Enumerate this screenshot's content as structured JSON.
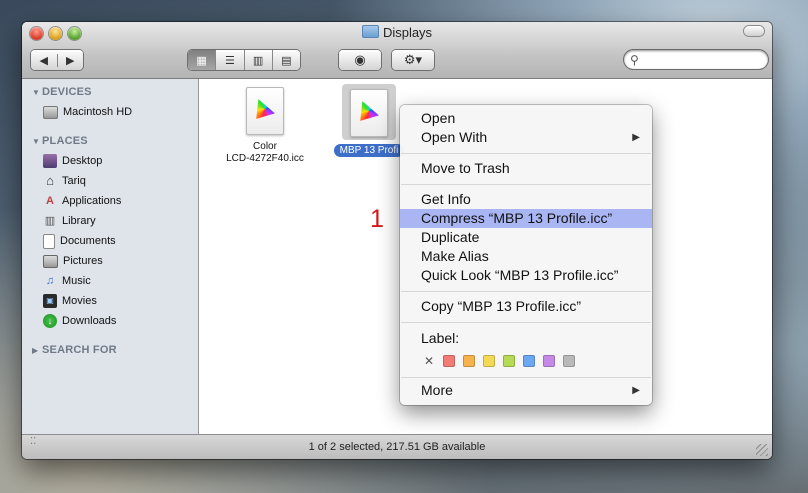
{
  "window": {
    "title": "Displays"
  },
  "toolbar": {
    "back_glyph": "◀",
    "forward_glyph": "▶",
    "view_icon_glyph": "▦",
    "view_list_glyph": "☰",
    "view_columns_glyph": "▥",
    "view_coverflow_glyph": "▤",
    "quicklook_glyph": "◉",
    "action_glyph": "⚙▾",
    "search_icon_glyph": "⚲",
    "search_placeholder": ""
  },
  "sidebar": {
    "sections": [
      {
        "title": "DEVICES",
        "items": [
          {
            "label": "Macintosh HD",
            "icon": "hard-drive-icon"
          }
        ]
      },
      {
        "title": "PLACES",
        "items": [
          {
            "label": "Desktop",
            "icon": "desktop-icon"
          },
          {
            "label": "Tariq",
            "icon": "home-icon"
          },
          {
            "label": "Applications",
            "icon": "applications-icon"
          },
          {
            "label": "Library",
            "icon": "library-icon"
          },
          {
            "label": "Documents",
            "icon": "documents-icon"
          },
          {
            "label": "Pictures",
            "icon": "pictures-icon"
          },
          {
            "label": "Music",
            "icon": "music-icon"
          },
          {
            "label": "Movies",
            "icon": "movies-icon"
          },
          {
            "label": "Downloads",
            "icon": "downloads-icon"
          }
        ]
      },
      {
        "title": "SEARCH FOR",
        "items": []
      }
    ]
  },
  "files": [
    {
      "name_line1": "Color",
      "name_line2": "LCD-4272F40.icc",
      "selected": false
    },
    {
      "name": "MBP 13 Profi",
      "selected": true
    }
  ],
  "annotation": "1",
  "context_menu": {
    "items": [
      {
        "label": "Open"
      },
      {
        "label": "Open With",
        "submenu": true
      },
      {
        "label": "Move to Trash"
      },
      {
        "label": "Get Info"
      },
      {
        "label": "Compress “MBP 13 Profile.icc”",
        "highlighted": true
      },
      {
        "label": "Duplicate"
      },
      {
        "label": "Make Alias"
      },
      {
        "label": "Quick Look “MBP 13 Profile.icc”"
      },
      {
        "label": "Copy “MBP 13 Profile.icc”"
      },
      {
        "label": "Label:"
      },
      {
        "label": "More",
        "submenu": true
      }
    ],
    "submenu_arrow": "▶",
    "label_clear_glyph": "✕",
    "label_colors": [
      "#f27b75",
      "#f5b24d",
      "#f3da55",
      "#b6da55",
      "#6ca7f2",
      "#c58ae6",
      "#b9b9b9"
    ]
  },
  "statusbar": {
    "text": "1 of 2 selected, 217.51 GB available"
  }
}
